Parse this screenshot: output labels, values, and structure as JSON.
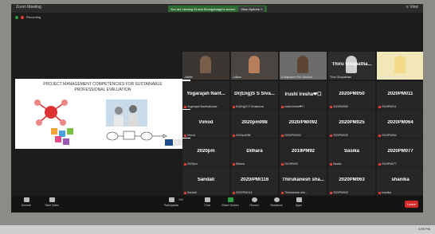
{
  "window": {
    "title": "Zoom Meeting",
    "banner_text": "You are viewing Sr.sha Kirangamage's screen",
    "view_options": "View Options ˅",
    "speaker_view": "≡ View"
  },
  "recording": {
    "label": "Recording"
  },
  "share": {
    "title_line1": "PROJECT MANAGEMENT COMPETENCIES FOR SUSTAINABLE",
    "title_line2": "PROFESSIONAL EVALUATION"
  },
  "video_tiles": [
    {
      "label": "Juliette"
    },
    {
      "label": "Juliane"
    },
    {
      "label": "A.Wijeratne PhD Student"
    },
    {
      "name": "Thiru Sivapatha...",
      "label": "Thiru Sivapatham"
    },
    {
      "label": "Kirangamage Shiroma"
    }
  ],
  "tiles": [
    {
      "name": "Yogarajah Nant...",
      "label": "Yogarajah Nanthakumar"
    },
    {
      "name": "Dr(Eng)S S Siva...",
      "label": "Dr(Eng)S S Sivakumar"
    },
    {
      "name": "irushi iresha❤☐",
      "label": "irushi iresha❤☐"
    },
    {
      "name": "2020PM050",
      "label": "2020PM050"
    },
    {
      "name": "2020PM011",
      "label": "2020PM011"
    },
    {
      "name": "Vimod",
      "label": "Vimod"
    },
    {
      "name": "2020pm098",
      "label": "2020pm098"
    },
    {
      "name": "2020/PM/092",
      "label": "2020/PM/092"
    },
    {
      "name": "2020PM025",
      "label": "2020PM025"
    },
    {
      "name": "2020PM064",
      "label": "2020PM064"
    },
    {
      "name": "2020pm",
      "label": "2020pm"
    },
    {
      "name": "Dilhara",
      "label": "Dilhara"
    },
    {
      "name": "2019PM92",
      "label": "2019PM92"
    },
    {
      "name": "Sasika",
      "label": "Sasika"
    },
    {
      "name": "2020PM077",
      "label": "2020PM077"
    },
    {
      "name": "Sandali",
      "label": "Sandali"
    },
    {
      "name": "2020/PM/116",
      "label": "2020/PM/116"
    },
    {
      "name": "Thirukanesh sha...",
      "label": "Thirukanesh sha..."
    },
    {
      "name": "2020PM063",
      "label": "2020PM063"
    },
    {
      "name": "shanika",
      "label": "shanika"
    }
  ],
  "toolbar": {
    "unmute": "Unmute",
    "start_video": "Start Video",
    "participants": "Participants",
    "participants_count": "104",
    "chat": "Chat",
    "share_screen": "Share Screen",
    "record": "Record",
    "reactions": "Reactions",
    "apps": "Apps",
    "leave": "Leave"
  },
  "taskbar": {
    "time": "4:35 PM"
  }
}
